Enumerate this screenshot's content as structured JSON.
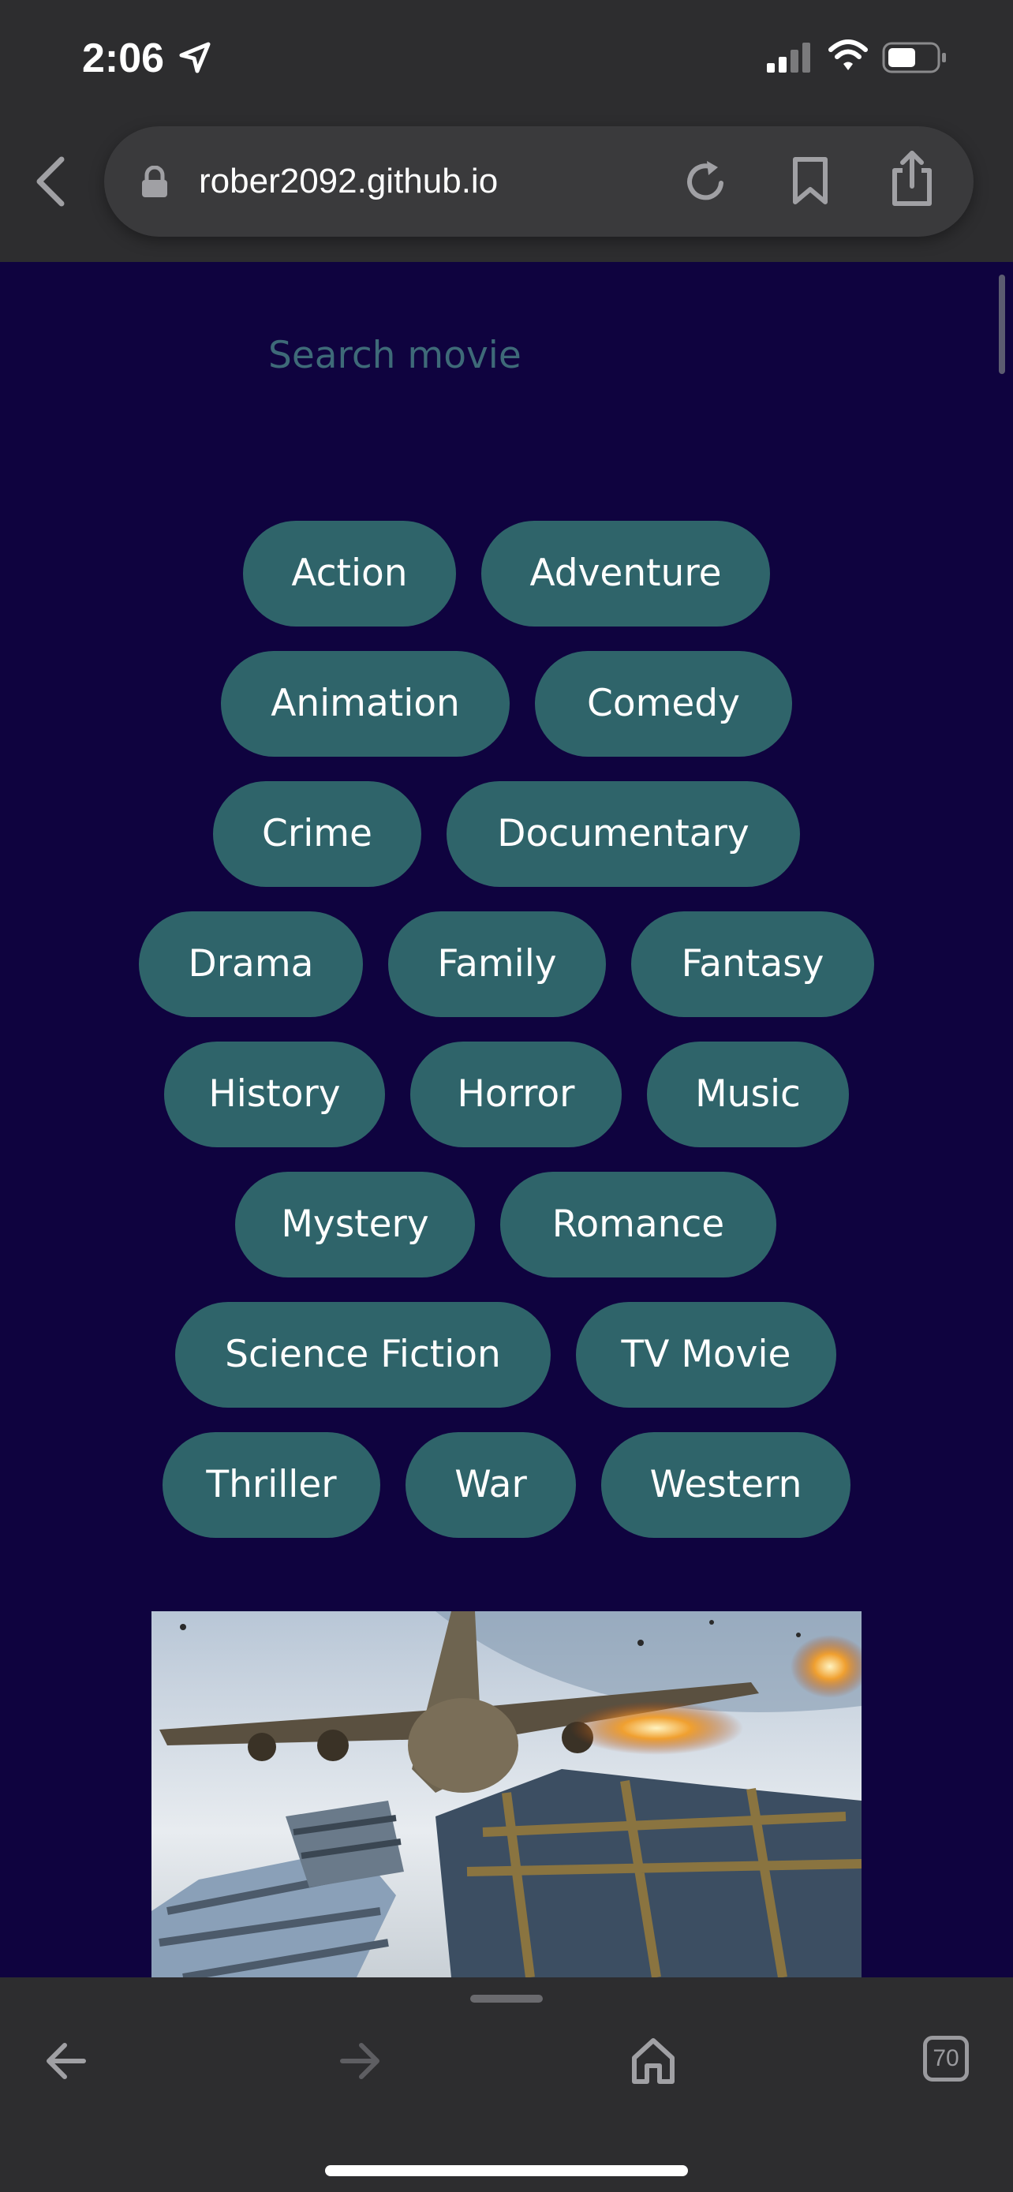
{
  "status_bar": {
    "time": "2:06",
    "icons": [
      "location-arrow-icon",
      "cellular-signal-icon",
      "wifi-icon",
      "battery-icon"
    ]
  },
  "browser": {
    "url": "rober2092.github.io",
    "icons": [
      "back-chevron-icon",
      "lock-icon",
      "reload-icon",
      "bookmark-icon",
      "share-icon"
    ]
  },
  "search": {
    "placeholder": "Search movie"
  },
  "genres": [
    "Action",
    "Adventure",
    "Animation",
    "Comedy",
    "Crime",
    "Documentary",
    "Drama",
    "Family",
    "Fantasy",
    "History",
    "Horror",
    "Music",
    "Mystery",
    "Romance",
    "Science Fiction",
    "TV Movie",
    "Thriller",
    "War",
    "Western"
  ],
  "bottom_toolbar": {
    "tabs_count": "70",
    "icons": [
      "arrow-back-icon",
      "arrow-forward-icon",
      "home-icon",
      "tabs-icon"
    ]
  },
  "colors": {
    "page_background": "#0f033f",
    "genre_button": "#2f646a",
    "placeholder": "#3e6a78",
    "browser_chrome": "#2d2d2f"
  }
}
